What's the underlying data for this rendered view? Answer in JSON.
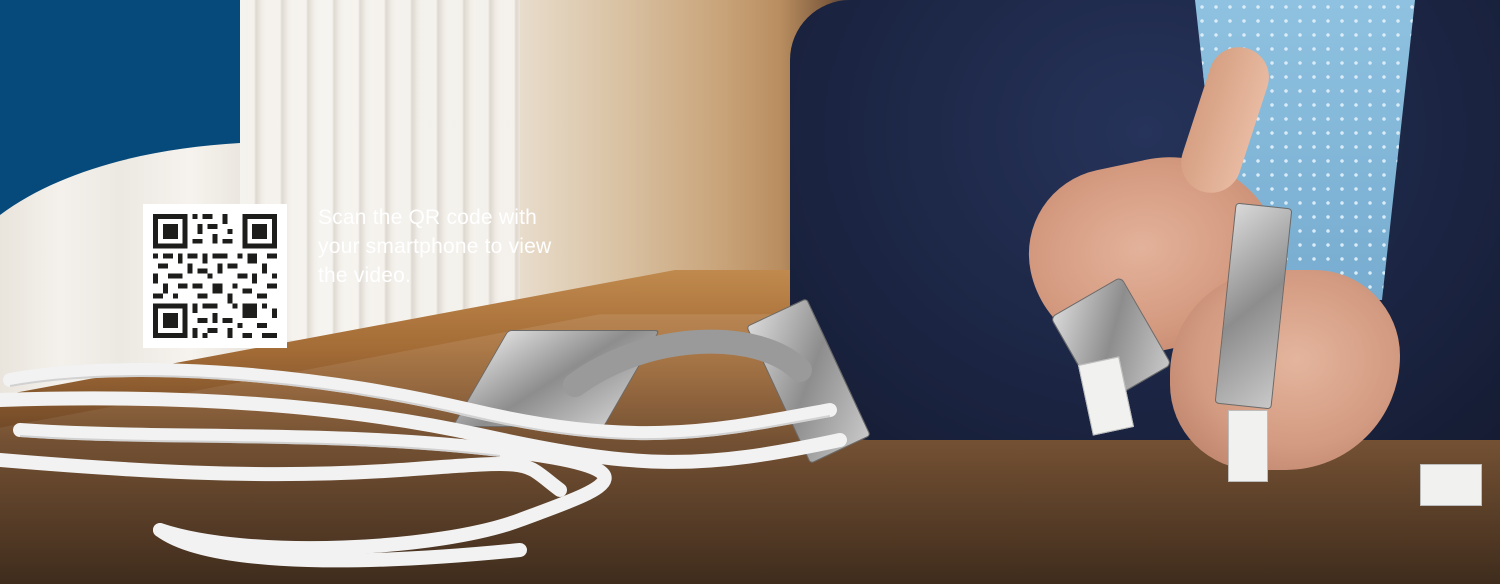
{
  "scene": {
    "description_icons": [
      "qr-code-icon"
    ],
    "colors": {
      "brand_blue": "#064a7c",
      "caption_text": "#ffffff"
    }
  },
  "overlay": {
    "caption_lines": [
      "Scan the QR code with",
      "your smartphone to view",
      "the video."
    ]
  }
}
